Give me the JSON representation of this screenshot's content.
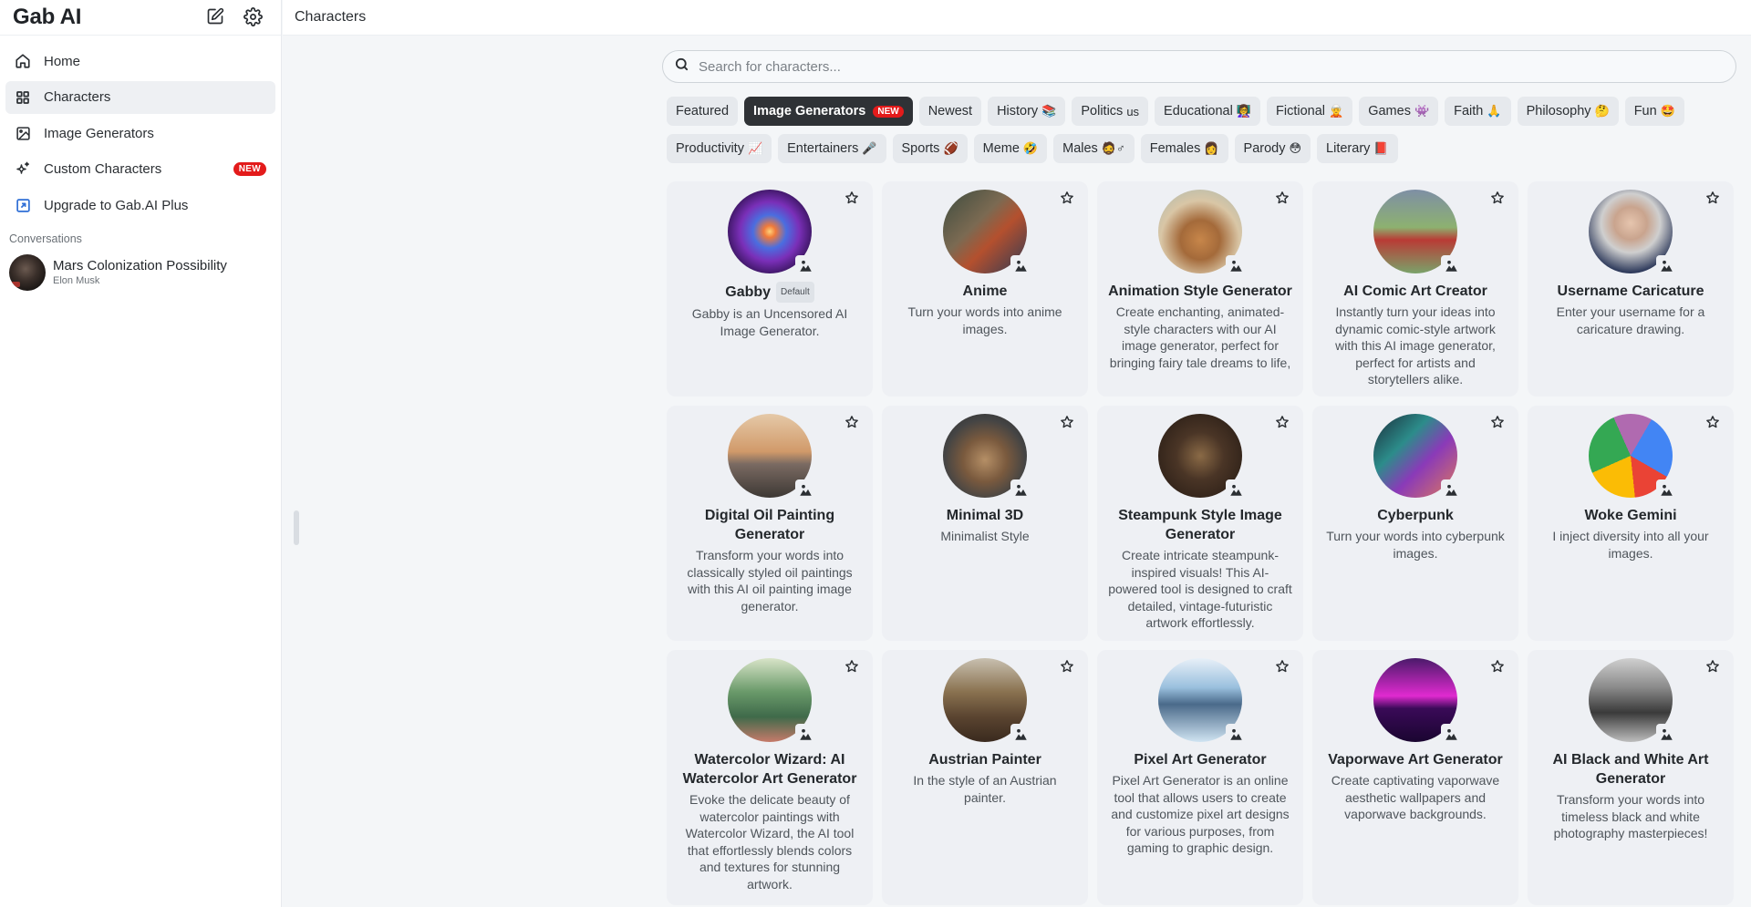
{
  "app": {
    "brand": "Gab AI",
    "page_title": "Characters"
  },
  "sidebar": {
    "items": [
      {
        "label": "Home",
        "icon": "home-icon"
      },
      {
        "label": "Characters",
        "icon": "grid-icon",
        "active": true
      },
      {
        "label": "Image Generators",
        "icon": "image-icon"
      },
      {
        "label": "Custom Characters",
        "icon": "sparkle-icon",
        "badge": "NEW"
      },
      {
        "label": "Upgrade to Gab.AI Plus",
        "icon": "external-link-icon"
      }
    ],
    "conversations_label": "Conversations",
    "conversations": [
      {
        "title": "Mars Colonization Possibility",
        "subtitle": "Elon Musk"
      }
    ]
  },
  "search": {
    "placeholder": "Search for characters..."
  },
  "categories": {
    "row1": [
      {
        "label": "Featured",
        "emoji": ""
      },
      {
        "label": "Image Generators",
        "emoji": "",
        "badge": "NEW",
        "active": true
      },
      {
        "label": "Newest",
        "emoji": ""
      },
      {
        "label": "History",
        "emoji": "📚"
      },
      {
        "label": "Politics",
        "emoji": "us"
      },
      {
        "label": "Educational",
        "emoji": "👩‍🏫"
      },
      {
        "label": "Fictional",
        "emoji": "🧝"
      },
      {
        "label": "Games",
        "emoji": "👾"
      },
      {
        "label": "Faith",
        "emoji": "🙏"
      },
      {
        "label": "Philosophy",
        "emoji": "🤔"
      },
      {
        "label": "Fun",
        "emoji": "🤩"
      }
    ],
    "row2": [
      {
        "label": "Productivity",
        "emoji": "📈"
      },
      {
        "label": "Entertainers",
        "emoji": "🎤"
      },
      {
        "label": "Sports",
        "emoji": "🏈"
      },
      {
        "label": "Meme",
        "emoji": "🤣"
      },
      {
        "label": "Males",
        "emoji": "🧔♂"
      },
      {
        "label": "Females",
        "emoji": "👩"
      },
      {
        "label": "Parody",
        "emoji": "😳"
      },
      {
        "label": "Literary",
        "emoji": "📕"
      }
    ]
  },
  "characters": [
    {
      "name": "Gabby",
      "tag": "Default",
      "description": "Gabby is an Uncensored AI Image Generator."
    },
    {
      "name": "Anime",
      "description": "Turn your words into anime images."
    },
    {
      "name": "Animation Style Generator",
      "description": "Create enchanting, animated-style characters with our AI image generator, perfect for bringing fairy tale dreams to life,"
    },
    {
      "name": "AI Comic Art Creator",
      "description": "Instantly turn your ideas into dynamic comic-style artwork with this AI image generator, perfect for artists and storytellers alike."
    },
    {
      "name": "Username Caricature",
      "description": "Enter your username for a caricature drawing."
    },
    {
      "name": "Digital Oil Painting Generator",
      "description": "Transform your words into classically styled oil paintings with this AI oil painting image generator."
    },
    {
      "name": "Minimal 3D",
      "description": "Minimalist Style"
    },
    {
      "name": "Steampunk Style Image Generator",
      "description": "Create intricate steampunk-inspired visuals! This AI-powered tool is designed to craft detailed, vintage-futuristic artwork effortlessly."
    },
    {
      "name": "Cyberpunk",
      "description": "Turn your words into cyberpunk images."
    },
    {
      "name": "Woke Gemini",
      "description": "I inject diversity into all your images."
    },
    {
      "name": "Watercolor Wizard: AI Watercolor Art Generator",
      "description": "Evoke the delicate beauty of watercolor paintings with Watercolor Wizard, the AI tool that effortlessly blends colors and textures for stunning artwork."
    },
    {
      "name": "Austrian Painter",
      "description": "In the style of an Austrian painter."
    },
    {
      "name": "Pixel Art Generator",
      "description": "Pixel Art Generator is an online tool that allows users to create and customize pixel art designs for various purposes, from gaming to graphic design."
    },
    {
      "name": "Vaporwave Art Generator",
      "description": "Create captivating vaporwave aesthetic wallpapers and vaporwave backgrounds."
    },
    {
      "name": "AI Black and White Art Generator",
      "description": "Transform your words into timeless black and white photography masterpieces!"
    }
  ],
  "colors": {
    "new_badge": "#e31b1b",
    "active_chip": "#2f3236",
    "card_bg": "#eef0f4"
  }
}
